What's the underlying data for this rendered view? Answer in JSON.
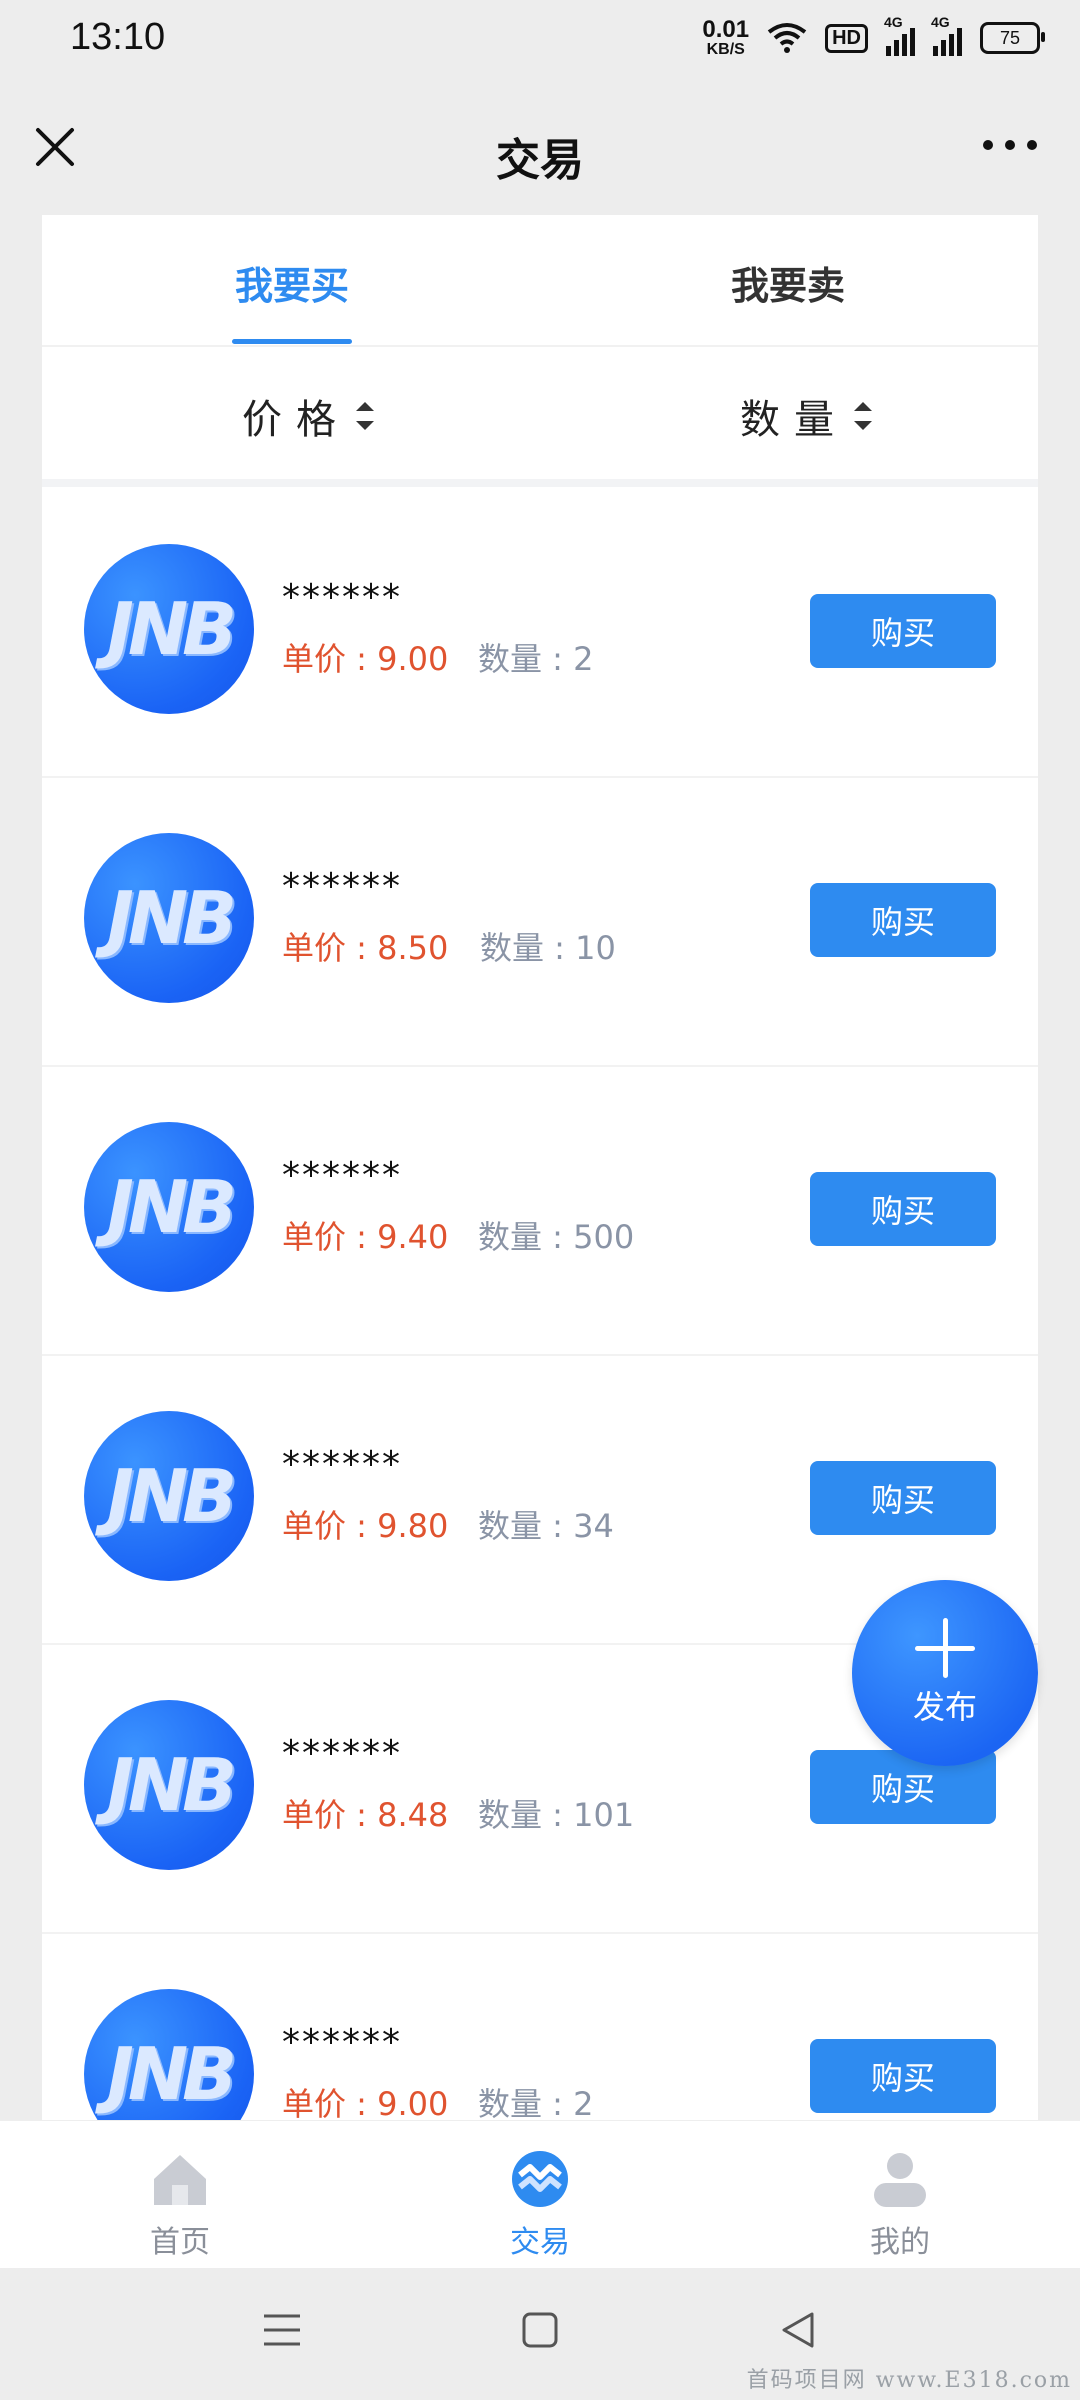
{
  "status_bar": {
    "time": "13:10",
    "net_speed_value": "0.01",
    "net_speed_unit": "KB/S",
    "hd_label": "HD",
    "signal_1_label": "4G",
    "signal_2_label": "4G",
    "battery": "75"
  },
  "header": {
    "title": "交易",
    "close_icon": "close-icon",
    "more_icon": "more-icon"
  },
  "tabs": [
    {
      "label": "我要买",
      "active": true
    },
    {
      "label": "我要卖",
      "active": false
    }
  ],
  "sort": {
    "price_label": "价格",
    "quantity_label": "数量"
  },
  "listings": [
    {
      "avatar_text": "JNB",
      "name": "******",
      "price": "单价 : 9.00",
      "quantity": "数量 : 2",
      "button": "购买"
    },
    {
      "avatar_text": "JNB",
      "name": "******",
      "price": "单价 : 8.50",
      "quantity": "数量 : 10",
      "button": "购买"
    },
    {
      "avatar_text": "JNB",
      "name": "******",
      "price": "单价 : 9.40",
      "quantity": "数量 : 500",
      "button": "购买"
    },
    {
      "avatar_text": "JNB",
      "name": "******",
      "price": "单价 : 9.80",
      "quantity": "数量 : 34",
      "button": "购买"
    },
    {
      "avatar_text": "JNB",
      "name": "******",
      "price": "单价 : 8.48",
      "quantity": "数量 : 101",
      "button": "购买"
    },
    {
      "avatar_text": "JNB",
      "name": "******",
      "price": "单价 : 9.00",
      "quantity": "数量 : 2",
      "button": "购买"
    }
  ],
  "fab": {
    "label": "发布"
  },
  "bottom_nav": [
    {
      "label": "首页",
      "icon": "home-icon",
      "active": false
    },
    {
      "label": "交易",
      "icon": "trade-icon",
      "active": true
    },
    {
      "label": "我的",
      "icon": "profile-icon",
      "active": false
    }
  ],
  "colors": {
    "accent": "#2e8bf0",
    "price": "#e0532f",
    "muted": "#8a94a6"
  },
  "watermark": "首码项目网 www.E318.com"
}
